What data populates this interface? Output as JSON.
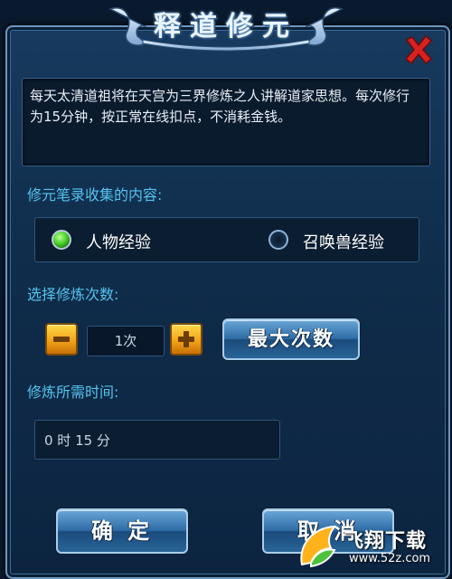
{
  "dialog": {
    "title": "释道修元",
    "description": "每天太清道祖将在天宫为三界修炼之人讲解道家思想。每次修行为15分钟，按正常在线扣点，不消耗金钱。"
  },
  "collect_section": {
    "label": "修元笔录收集的内容:",
    "options": [
      {
        "label": "人物经验",
        "selected": true
      },
      {
        "label": "召唤兽经验",
        "selected": false
      }
    ]
  },
  "count_section": {
    "label": "选择修炼次数:",
    "value": "1次",
    "max_button": "最大次数"
  },
  "time_section": {
    "label": "修炼所需时间:",
    "value": "0 时 15 分"
  },
  "buttons": {
    "confirm": "确 定",
    "cancel": "取 消"
  },
  "watermark": {
    "brand": "飞翔下载",
    "url": "www.52z.com"
  },
  "colors": {
    "accent_label": "#55c3ee",
    "close_red": "#d8221f",
    "radio_selected": "#4bd12c",
    "stepper_gold": "#f3a41a"
  }
}
